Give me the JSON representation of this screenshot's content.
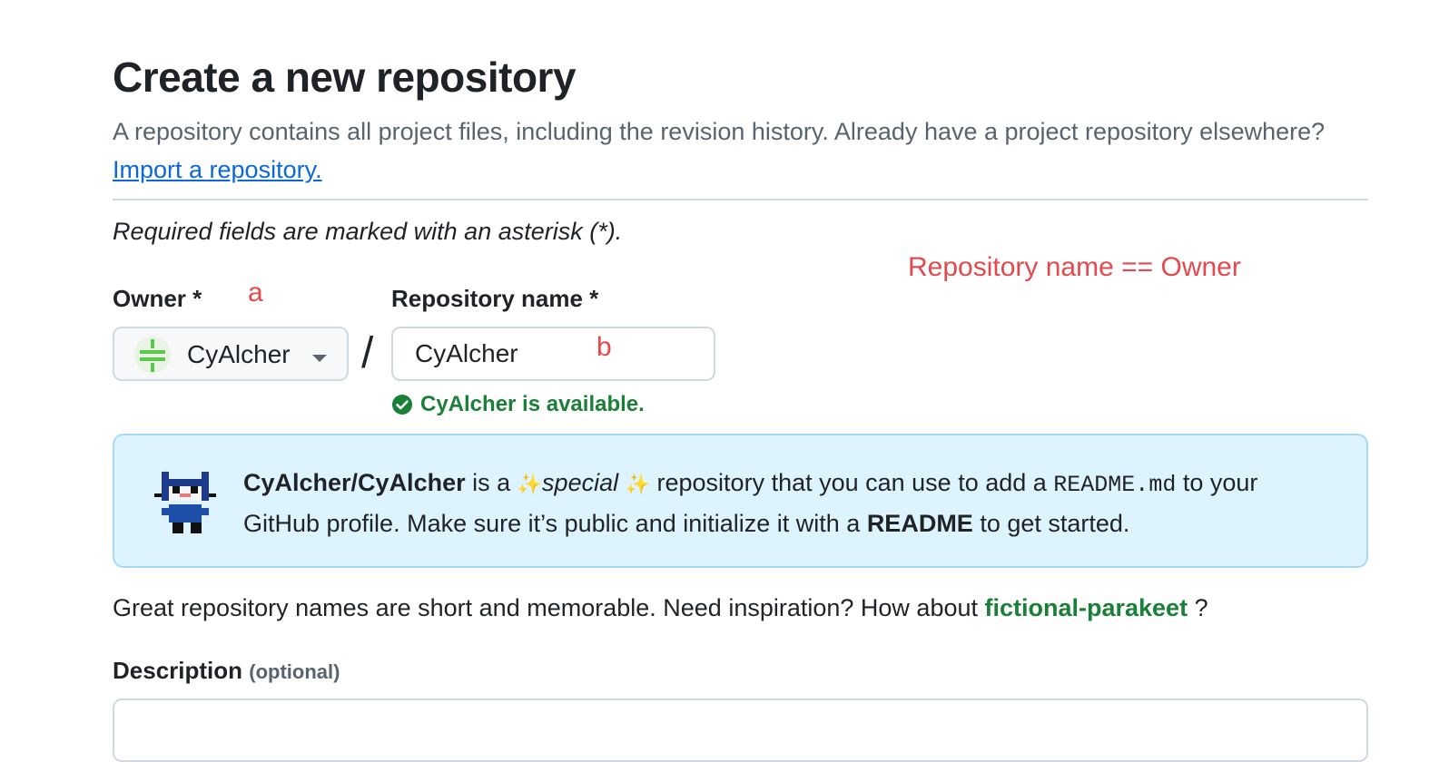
{
  "page": {
    "title": "Create a new repository",
    "intro_text": "A repository contains all project files, including the revision history. Already have a project repository elsewhere?",
    "import_link": "Import a repository.",
    "required_note": "Required fields are marked with an asterisk (*)."
  },
  "annotations": {
    "equality_note": "Repository name == Owner",
    "owner_marker": "a",
    "name_marker": "b"
  },
  "owner": {
    "label": "Owner *",
    "value": "CyAlcher",
    "avatar_icon": "identicon-avatar",
    "dropdown_icon": "caret-down-icon"
  },
  "separator": "/",
  "repository": {
    "label": "Repository name *",
    "value": "CyAlcher",
    "availability": "CyAlcher is available.",
    "availability_icon": "check-circle-icon"
  },
  "callout": {
    "repo_path": "CyAlcher/CyAlcher",
    "text_1": " is a ",
    "sparkle": "✨",
    "special": "special",
    "text_2": " repository that you can use to add a ",
    "readme_file": "README.md",
    "text_3": " to your GitHub profile. Make sure it’s public and initialize it with a ",
    "readme_word": "README",
    "text_4": " to get started.",
    "mascot_icon": "octocat-mascot-icon"
  },
  "hint": {
    "text": "Great repository names are short and memorable. Need inspiration? How about ",
    "suggestion": "fictional-parakeet",
    "end": " ?"
  },
  "description": {
    "label": "Description",
    "optional": "(optional)",
    "value": ""
  },
  "colors": {
    "link": "#0969da",
    "success": "#1a7f37",
    "annotation": "#e5484d",
    "callout_bg": "#ddf4ff"
  }
}
